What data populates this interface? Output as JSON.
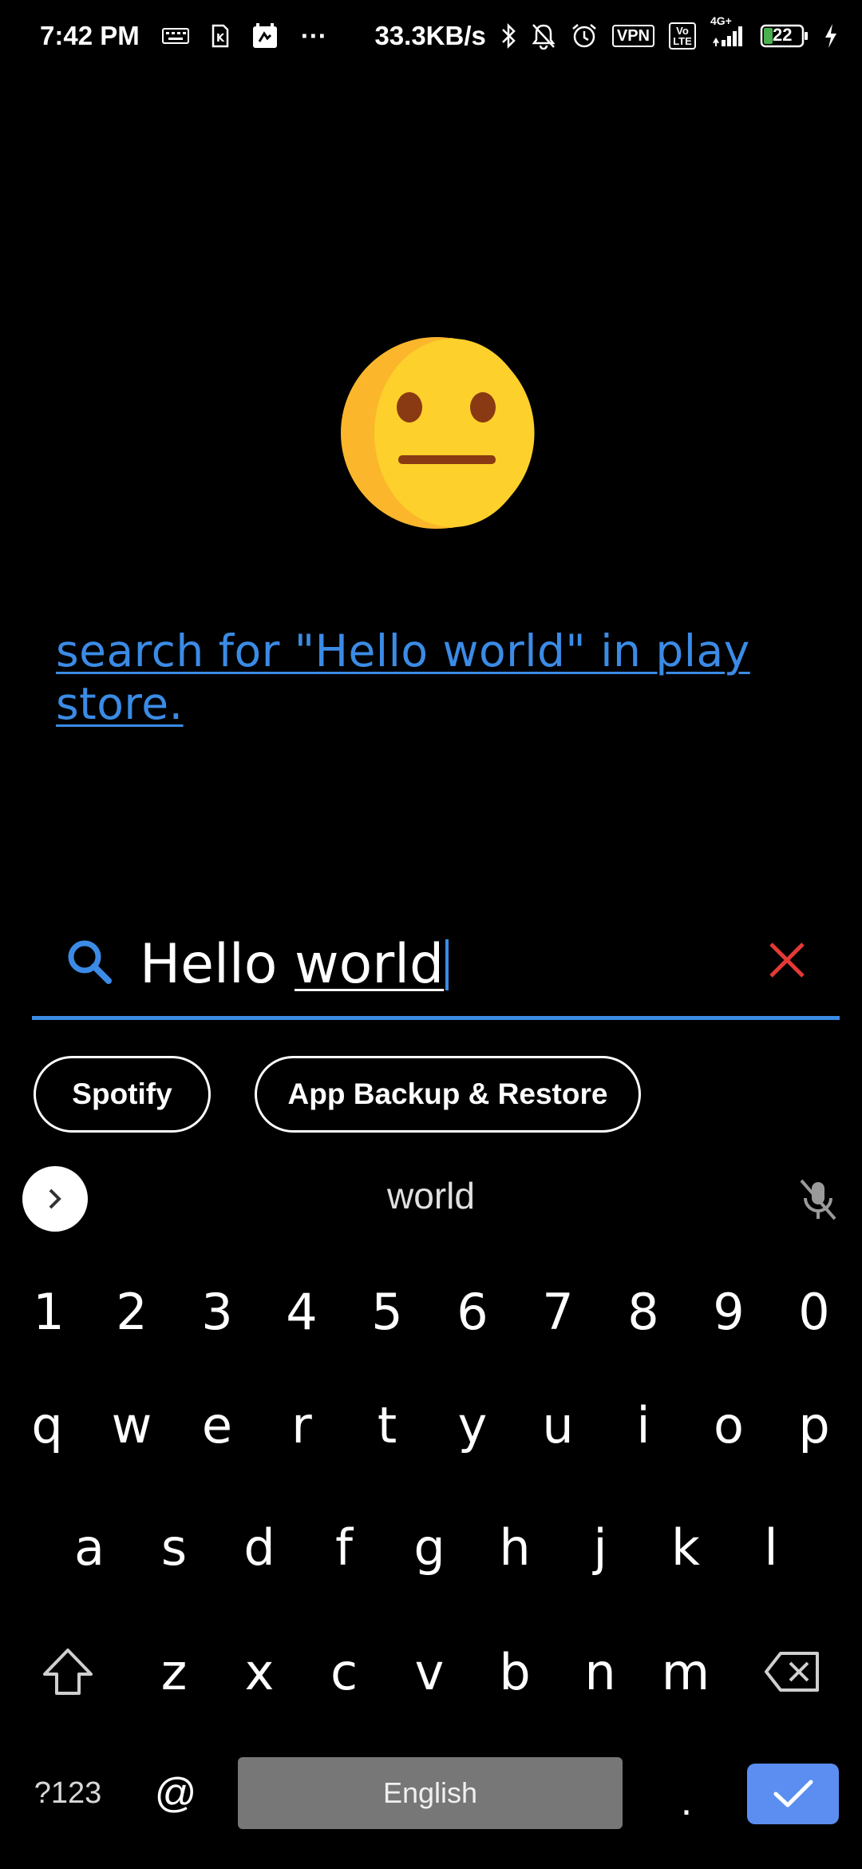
{
  "status_bar": {
    "time": "7:42 PM",
    "dots": "···",
    "net_speed": "33.3KB/s",
    "vpn": "VPN",
    "volte": "Vo LTE",
    "network": "4G+",
    "battery": "22",
    "icons": [
      "keyboard-icon",
      "sim-icon",
      "calendar-icon",
      "bluetooth-icon",
      "bell-off-icon",
      "alarm-icon",
      "signal-icon",
      "charging-icon"
    ]
  },
  "emoji": {
    "name": "neutral-face-emoji",
    "color": "#fdd02c"
  },
  "store_link": {
    "text": "search for \"Hello world\" in play store.",
    "color": "#3b8be6"
  },
  "search": {
    "value_plain": "Hello ",
    "value_composing": "world",
    "accent": "#3b8be6",
    "clear_color": "#e53935"
  },
  "chips": [
    {
      "label": "Spotify"
    },
    {
      "label": "App Backup & Restore"
    }
  ],
  "keyboard": {
    "suggestion": "world",
    "numbers": [
      "1",
      "2",
      "3",
      "4",
      "5",
      "6",
      "7",
      "8",
      "9",
      "0"
    ],
    "row1": [
      "q",
      "w",
      "e",
      "r",
      "t",
      "y",
      "u",
      "i",
      "o",
      "p"
    ],
    "row2": [
      "a",
      "s",
      "d",
      "f",
      "g",
      "h",
      "j",
      "k",
      "l"
    ],
    "row3": [
      "z",
      "x",
      "c",
      "v",
      "b",
      "n",
      "m"
    ],
    "symbols_label": "?123",
    "at_label": "@",
    "space_label": "English",
    "period_label": ".",
    "enter_color": "#5b8ef0"
  }
}
